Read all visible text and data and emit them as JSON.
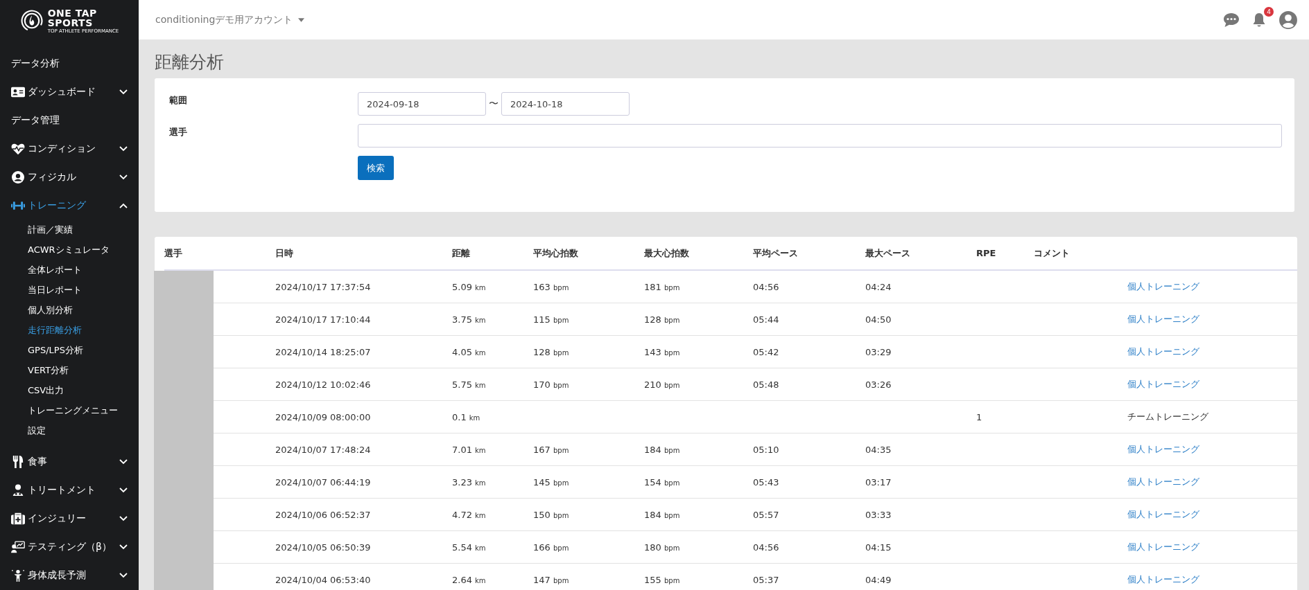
{
  "logo": {
    "line1": "ONE TAP",
    "line2": "SPORTS",
    "tagline": "TOP ATHLETE PERFORMANCE"
  },
  "sidebar": {
    "items": [
      {
        "kind": "label",
        "label": "データ分析"
      },
      {
        "kind": "group",
        "label": "ダッシュボード",
        "expanded": false
      },
      {
        "kind": "label",
        "label": "データ管理"
      },
      {
        "kind": "group",
        "label": "コンディション",
        "expanded": false
      },
      {
        "kind": "group",
        "label": "フィジカル",
        "expanded": false
      },
      {
        "kind": "group",
        "label": "トレーニング",
        "expanded": true,
        "children": [
          {
            "label": "計画／実績",
            "selected": false
          },
          {
            "label": "ACWRシミュレータ",
            "selected": false
          },
          {
            "label": "全体レポート",
            "selected": false
          },
          {
            "label": "当日レポート",
            "selected": false
          },
          {
            "label": "個人別分析",
            "selected": false
          },
          {
            "label": "走行距離分析",
            "selected": true
          },
          {
            "label": "GPS/LPS分析",
            "selected": false
          },
          {
            "label": "VERT分析",
            "selected": false
          },
          {
            "label": "CSV出力",
            "selected": false
          },
          {
            "label": "トレーニングメニュー",
            "selected": false
          },
          {
            "label": "設定",
            "selected": false
          }
        ]
      },
      {
        "kind": "group",
        "label": "食事",
        "expanded": false
      },
      {
        "kind": "group",
        "label": "トリートメント",
        "expanded": false
      },
      {
        "kind": "group",
        "label": "インジュリー",
        "expanded": false
      },
      {
        "kind": "group",
        "label": "テスティング（β）",
        "expanded": false
      },
      {
        "kind": "group",
        "label": "身体成長予測",
        "expanded": false
      }
    ]
  },
  "header": {
    "account": "conditioningデモ用アカウント",
    "notification_count": "4"
  },
  "page_title": "距離分析",
  "form": {
    "range_label": "範囲",
    "range_from": "2024-09-18",
    "range_separator": "〜",
    "range_to": "2024-10-18",
    "player_label": "選手",
    "search_button": "検索"
  },
  "table": {
    "columns": [
      "選手",
      "日時",
      "距離",
      "平均心拍数",
      "最大心拍数",
      "平均ペース",
      "最大ペース",
      "RPE",
      "コメント"
    ],
    "rows": [
      {
        "datetime": "2024/10/17 17:37:54",
        "distance": {
          "value": "5.09",
          "unit": "km"
        },
        "avg_hr": {
          "value": "163",
          "unit": "bpm"
        },
        "max_hr": {
          "value": "181",
          "unit": "bpm"
        },
        "avg_pace": "04:56",
        "max_pace": "04:24",
        "training": {
          "kind": "link",
          "text": "個人トレーニング"
        }
      },
      {
        "datetime": "2024/10/17 17:10:44",
        "distance": {
          "value": "3.75",
          "unit": "km"
        },
        "avg_hr": {
          "value": "115",
          "unit": "bpm"
        },
        "max_hr": {
          "value": "128",
          "unit": "bpm"
        },
        "avg_pace": "05:44",
        "max_pace": "04:50",
        "training": {
          "kind": "link",
          "text": "個人トレーニング"
        }
      },
      {
        "datetime": "2024/10/14 18:25:07",
        "distance": {
          "value": "4.05",
          "unit": "km"
        },
        "avg_hr": {
          "value": "128",
          "unit": "bpm"
        },
        "max_hr": {
          "value": "143",
          "unit": "bpm"
        },
        "avg_pace": "05:42",
        "max_pace": "03:29",
        "training": {
          "kind": "link",
          "text": "個人トレーニング"
        }
      },
      {
        "datetime": "2024/10/12 10:02:46",
        "distance": {
          "value": "5.75",
          "unit": "km"
        },
        "avg_hr": {
          "value": "170",
          "unit": "bpm"
        },
        "max_hr": {
          "value": "210",
          "unit": "bpm"
        },
        "avg_pace": "05:48",
        "max_pace": "03:26",
        "training": {
          "kind": "link",
          "text": "個人トレーニング"
        }
      },
      {
        "datetime": "2024/10/09 08:00:00",
        "distance": {
          "value": "0.1",
          "unit": "km"
        },
        "rpe": "1",
        "training": {
          "kind": "text",
          "text": "チームトレーニング"
        }
      },
      {
        "datetime": "2024/10/07 17:48:24",
        "distance": {
          "value": "7.01",
          "unit": "km"
        },
        "avg_hr": {
          "value": "167",
          "unit": "bpm"
        },
        "max_hr": {
          "value": "184",
          "unit": "bpm"
        },
        "avg_pace": "05:10",
        "max_pace": "04:35",
        "training": {
          "kind": "link",
          "text": "個人トレーニング"
        }
      },
      {
        "datetime": "2024/10/07 06:44:19",
        "distance": {
          "value": "3.23",
          "unit": "km"
        },
        "avg_hr": {
          "value": "145",
          "unit": "bpm"
        },
        "max_hr": {
          "value": "154",
          "unit": "bpm"
        },
        "avg_pace": "05:43",
        "max_pace": "03:17",
        "training": {
          "kind": "link",
          "text": "個人トレーニング"
        }
      },
      {
        "datetime": "2024/10/06 06:52:37",
        "distance": {
          "value": "4.72",
          "unit": "km"
        },
        "avg_hr": {
          "value": "150",
          "unit": "bpm"
        },
        "max_hr": {
          "value": "184",
          "unit": "bpm"
        },
        "avg_pace": "05:57",
        "max_pace": "03:33",
        "training": {
          "kind": "link",
          "text": "個人トレーニング"
        }
      },
      {
        "datetime": "2024/10/05 06:50:39",
        "distance": {
          "value": "5.54",
          "unit": "km"
        },
        "avg_hr": {
          "value": "166",
          "unit": "bpm"
        },
        "max_hr": {
          "value": "180",
          "unit": "bpm"
        },
        "avg_pace": "04:56",
        "max_pace": "04:15",
        "training": {
          "kind": "link",
          "text": "個人トレーニング"
        }
      },
      {
        "datetime": "2024/10/04 06:53:40",
        "distance": {
          "value": "2.64",
          "unit": "km"
        },
        "avg_hr": {
          "value": "147",
          "unit": "bpm"
        },
        "max_hr": {
          "value": "155",
          "unit": "bpm"
        },
        "avg_pace": "05:37",
        "max_pace": "04:49",
        "training": {
          "kind": "link",
          "text": "個人トレーニング"
        }
      }
    ]
  }
}
